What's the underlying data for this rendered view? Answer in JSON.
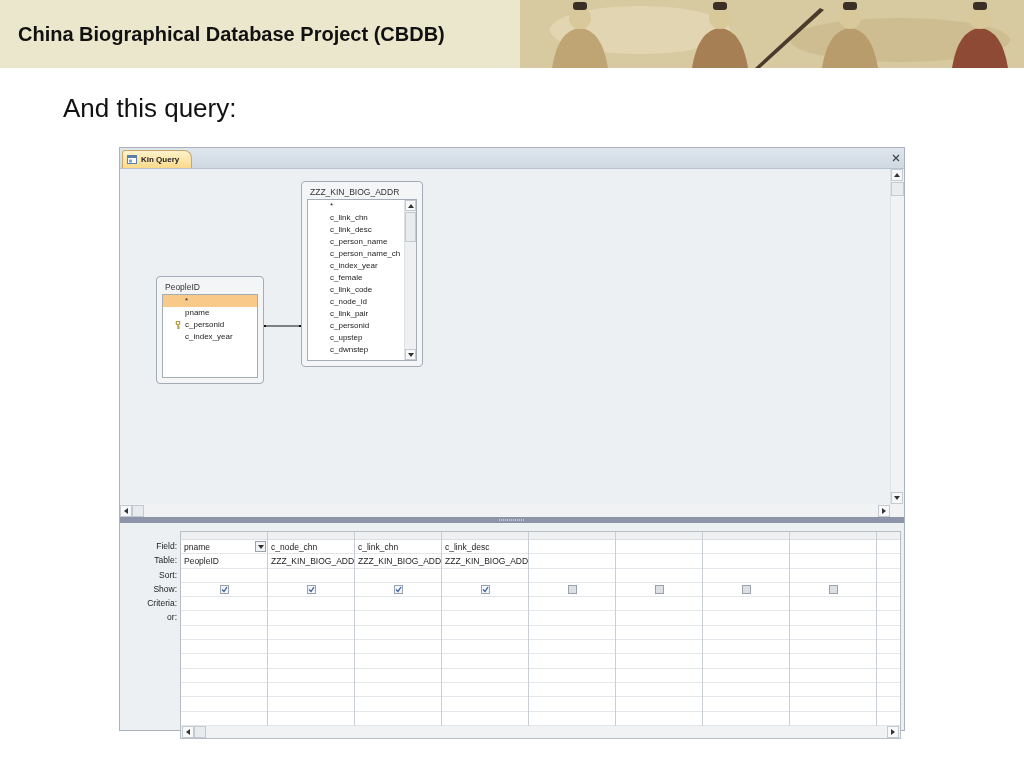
{
  "header": {
    "title": "China Biographical Database Project (CBDB)"
  },
  "subtitle": "And this query:",
  "window": {
    "tabs": [
      {
        "label": "Kin Query",
        "selected": true
      }
    ]
  },
  "tables": [
    {
      "name": "PeopleID",
      "scrollable": false,
      "fields": [
        {
          "label": "*",
          "selected": true,
          "key": false
        },
        {
          "label": "pname",
          "selected": false,
          "key": false
        },
        {
          "label": "c_personid",
          "selected": false,
          "key": true
        },
        {
          "label": "c_index_year",
          "selected": false,
          "key": false
        }
      ]
    },
    {
      "name": "ZZZ_KIN_BIOG_ADDR",
      "scrollable": true,
      "fields": [
        {
          "label": "*",
          "selected": false,
          "key": false
        },
        {
          "label": "c_link_chn",
          "selected": false,
          "key": false
        },
        {
          "label": "c_link_desc",
          "selected": false,
          "key": false
        },
        {
          "label": "c_person_name",
          "selected": false,
          "key": false
        },
        {
          "label": "c_person_name_ch",
          "selected": false,
          "key": false
        },
        {
          "label": "c_index_year",
          "selected": false,
          "key": false
        },
        {
          "label": "c_female",
          "selected": false,
          "key": false
        },
        {
          "label": "c_link_code",
          "selected": false,
          "key": false
        },
        {
          "label": "c_node_id",
          "selected": false,
          "key": false
        },
        {
          "label": "c_link_pair",
          "selected": false,
          "key": false
        },
        {
          "label": "c_personid",
          "selected": false,
          "key": false
        },
        {
          "label": "c_upstep",
          "selected": false,
          "key": false
        },
        {
          "label": "c_dwnstep",
          "selected": false,
          "key": false
        }
      ]
    }
  ],
  "grid": {
    "row_labels": [
      "Field:",
      "Table:",
      "Sort:",
      "Show:",
      "Criteria:",
      "or:"
    ],
    "columns": [
      {
        "field": "pname",
        "table": "PeopleID",
        "show": true,
        "dropdown": true
      },
      {
        "field": "c_node_chn",
        "table": "ZZZ_KIN_BIOG_ADD",
        "show": true,
        "dropdown": false
      },
      {
        "field": "c_link_chn",
        "table": "ZZZ_KIN_BIOG_ADD",
        "show": true,
        "dropdown": false
      },
      {
        "field": "c_link_desc",
        "table": "ZZZ_KIN_BIOG_ADD",
        "show": true,
        "dropdown": false
      },
      {
        "show": false,
        "dropdown": false
      },
      {
        "show": false,
        "dropdown": false
      },
      {
        "show": false,
        "dropdown": false
      },
      {
        "show": false,
        "dropdown": false
      },
      {
        "dropdown": false
      }
    ]
  }
}
